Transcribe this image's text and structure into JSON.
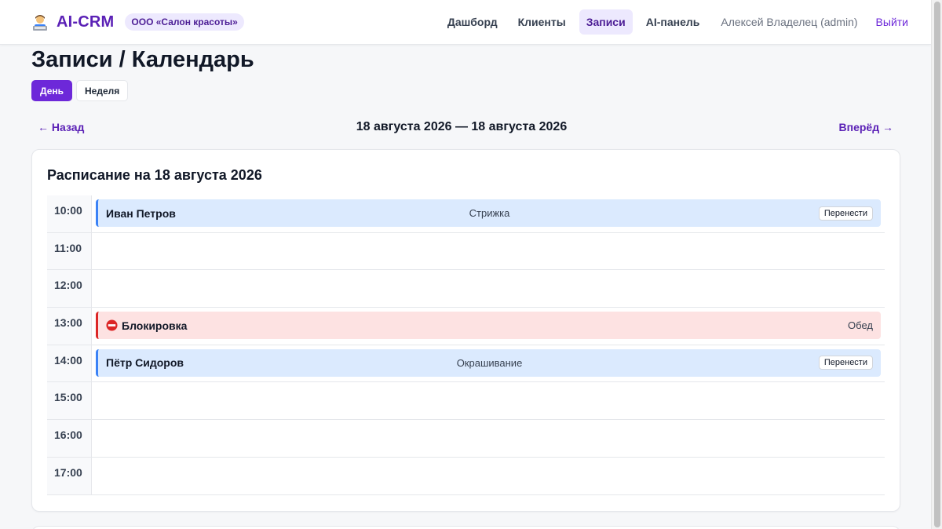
{
  "header": {
    "app_name": "AI-CRM",
    "logo_icon": "technologist-icon",
    "org": "ООО «Салон красоты»",
    "nav": [
      {
        "label": "Дашборд",
        "active": false
      },
      {
        "label": "Клиенты",
        "active": false
      },
      {
        "label": "Записи",
        "active": true
      },
      {
        "label": "AI-панель",
        "active": false
      }
    ],
    "user": "Алексей Владелец (admin)",
    "logout": "Выйти"
  },
  "page": {
    "title": "Записи / Календарь",
    "views": [
      {
        "label": "День",
        "active": true
      },
      {
        "label": "Неделя",
        "active": false
      }
    ]
  },
  "date_nav": {
    "prev": "← Назад",
    "range": "18 августа 2026 — 18 августа 2026",
    "next": "Вперёд →"
  },
  "schedule": {
    "title": "Расписание на 18 августа 2026",
    "reschedule_label": "Перенести",
    "slots": [
      {
        "time": "10:00",
        "event": {
          "kind": "appointment",
          "client": "Иван Петров",
          "service": "Стрижка"
        }
      },
      {
        "time": "11:00"
      },
      {
        "time": "12:00"
      },
      {
        "time": "13:00",
        "event": {
          "kind": "block",
          "label": "Блокировка",
          "note": "Обед"
        }
      },
      {
        "time": "14:00",
        "event": {
          "kind": "appointment",
          "client": "Пётр Сидоров",
          "service": "Окрашивание"
        }
      },
      {
        "time": "15:00"
      },
      {
        "time": "16:00"
      },
      {
        "time": "17:00"
      }
    ]
  },
  "colors": {
    "accent": "#6d28d9",
    "appointment_bg": "#dbeafe",
    "appointment_border": "#3b82f6",
    "block_bg": "#fde2e2",
    "block_border": "#dc2626"
  }
}
